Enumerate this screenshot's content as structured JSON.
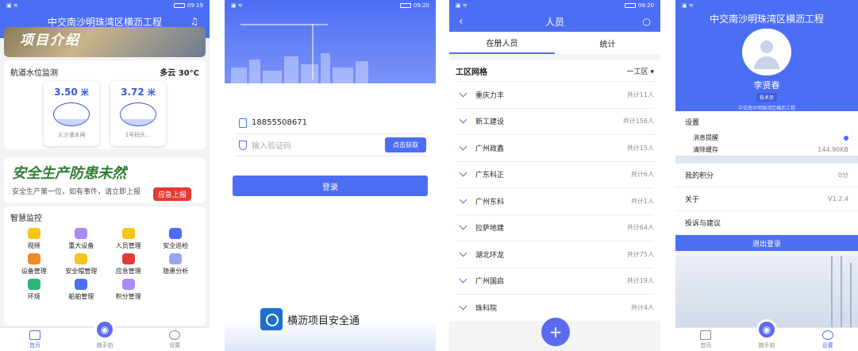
{
  "home": {
    "status_time": "09:19",
    "title": "中交南沙明珠湾区横沥工程",
    "banner_text": "项目介绍",
    "water": {
      "title": "航道水位监测",
      "weather": "多云 30°C",
      "gauges": [
        {
          "value": "3.50",
          "unit": "米",
          "label": "义沙涌水闸"
        },
        {
          "value": "3.72",
          "unit": "米",
          "label": "1号码头..."
        }
      ]
    },
    "safety": {
      "slogan": "安全生产防患未然",
      "note": "安全生产第一位，如有事件，请立即上报",
      "button": "应急上报"
    },
    "monitor": {
      "title": "智慧监控",
      "items": [
        {
          "label": "视频",
          "color": "#f5c518"
        },
        {
          "label": "重大设备",
          "color": "#a78bfa"
        },
        {
          "label": "人员管理",
          "color": "#f5c518"
        },
        {
          "label": "安全巡检",
          "color": "#4c6ef5"
        },
        {
          "label": "设备管理",
          "color": "#f08a24"
        },
        {
          "label": "安全帽管理",
          "color": "#f5c518"
        },
        {
          "label": "应急管理",
          "color": "#e53935"
        },
        {
          "label": "隐患分析",
          "color": "#9aa4f5"
        },
        {
          "label": "环境",
          "color": "#2bb673"
        },
        {
          "label": "船舶管理",
          "color": "#4c6ef5"
        },
        {
          "label": "积分管理",
          "color": "#a78bfa"
        }
      ]
    }
  },
  "tabbar": {
    "home": "首页",
    "snap": "随手拍",
    "settings": "设置"
  },
  "login": {
    "status_time": "09:20",
    "phone": "18855508671",
    "code_placeholder": "输入验证码",
    "get_code": "点击获取",
    "login_button": "登录",
    "brand": "横沥项目安全通"
  },
  "people": {
    "status_time": "09:20",
    "title": "人员",
    "tabs": [
      "在册人员",
      "统计"
    ],
    "group_label": "工区网格",
    "group_select": "一工区",
    "rows": [
      {
        "name": "重庆力丰",
        "count": "共计11人"
      },
      {
        "name": "新工建设",
        "count": "共计156人"
      },
      {
        "name": "广州政鑫",
        "count": "共计15人"
      },
      {
        "name": "广东科正",
        "count": "共计6人"
      },
      {
        "name": "广州东科",
        "count": "共计1人"
      },
      {
        "name": "拉萨地建",
        "count": "共计64人"
      },
      {
        "name": "湖北环龙",
        "count": "共计75人"
      },
      {
        "name": "广州国启",
        "count": "共计19人"
      },
      {
        "name": "珠科院",
        "count": "共计4人"
      }
    ],
    "fab": "+"
  },
  "profile": {
    "title": "中交南沙明珠湾区横沥工程",
    "name": "李贤春",
    "role": "技术员",
    "org": "中交南沙明珠湾区横沥工程",
    "settings_label": "设置",
    "notify": "消息提醒",
    "clear_cache": "清除缓存",
    "cache_size": "144.90KB",
    "points_label": "我的积分",
    "points": "0分",
    "about_label": "关于",
    "version": "V1.2.4",
    "complaint": "投诉与建议",
    "logout": "退出登录"
  }
}
